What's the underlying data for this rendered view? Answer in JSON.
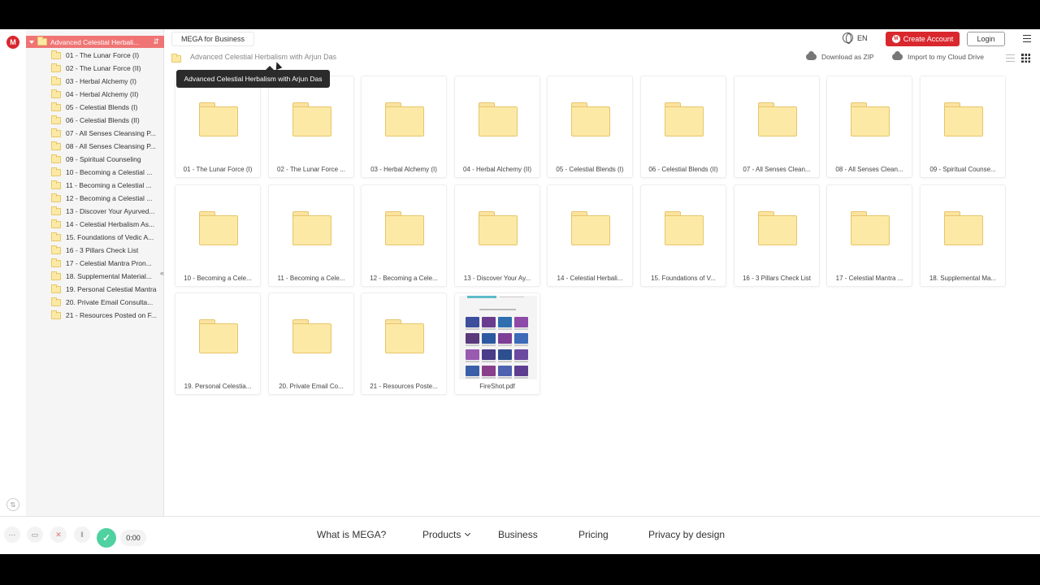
{
  "brand": {
    "logo_letter": "M"
  },
  "topbar": {
    "business_tab": "MEGA for Business",
    "language": "EN",
    "create_account": "Create Account",
    "login": "Login"
  },
  "breadcrumb": {
    "path": "Advanced Celestial Herbalism with Arjun Das",
    "download_zip": "Download as ZIP",
    "import": "Import to my Cloud Drive"
  },
  "tooltip": "Advanced Celestial Herbalism with Arjun Das",
  "tree": {
    "root": "Advanced Celestial Herbali...",
    "items": [
      "01 - The Lunar Force (I)",
      "02 - The Lunar Force (II)",
      "03 - Herbal Alchemy (I)",
      "04 - Herbal Alchemy (II)",
      "05 - Celestial Blends (I)",
      "06 - Celestial Blends (II)",
      "07 - All Senses Cleansing P...",
      "08 - All Senses Cleansing P...",
      "09 - Spiritual Counseling",
      "10 - Becoming a Celestial ...",
      "11 - Becoming a Celestial ...",
      "12 - Becoming a Celestial ...",
      "13 - Discover Your Ayurved...",
      "14 - Celestial Herbalism As...",
      "15. Foundations of Vedic A...",
      "16 - 3 Pillars Check List",
      "17 - Celestial Mantra Pron...",
      "18. Supplemental Material...",
      "19. Personal Celestial Mantra",
      "20. Private Email Consulta...",
      "21 - Resources Posted on F..."
    ]
  },
  "grid": {
    "items": [
      {
        "label": "01 - The Lunar Force (I)",
        "kind": "folder"
      },
      {
        "label": "02 - The Lunar Force ...",
        "kind": "folder"
      },
      {
        "label": "03 - Herbal Alchemy (I)",
        "kind": "folder"
      },
      {
        "label": "04 - Herbal Alchemy (II)",
        "kind": "folder"
      },
      {
        "label": "05 - Celestial Blends (I)",
        "kind": "folder"
      },
      {
        "label": "06 - Celestial Blends (II)",
        "kind": "folder"
      },
      {
        "label": "07 - All Senses Clean...",
        "kind": "folder"
      },
      {
        "label": "08 - All Senses Clean...",
        "kind": "folder"
      },
      {
        "label": "09 - Spiritual Counse...",
        "kind": "folder"
      },
      {
        "label": "10 - Becoming a Cele...",
        "kind": "folder"
      },
      {
        "label": "11 - Becoming a Cele...",
        "kind": "folder"
      },
      {
        "label": "12 - Becoming a Cele...",
        "kind": "folder"
      },
      {
        "label": "13 - Discover Your Ay...",
        "kind": "folder"
      },
      {
        "label": "14 - Celestial Herbali...",
        "kind": "folder"
      },
      {
        "label": "15. Foundations of V...",
        "kind": "folder"
      },
      {
        "label": "16 - 3 Pillars Check List",
        "kind": "folder"
      },
      {
        "label": "17 - Celestial Mantra ...",
        "kind": "folder"
      },
      {
        "label": "18. Supplemental Ma...",
        "kind": "folder"
      },
      {
        "label": "19. Personal Celestia...",
        "kind": "folder"
      },
      {
        "label": "20. Private Email Co...",
        "kind": "folder"
      },
      {
        "label": "21 - Resources Poste...",
        "kind": "folder"
      },
      {
        "label": "FireShot.pdf",
        "kind": "pdf"
      }
    ]
  },
  "footer": {
    "links": [
      "What is MEGA?",
      "Products",
      "Business",
      "Pricing",
      "Privacy by design"
    ]
  },
  "recorder": {
    "time": "0:00"
  },
  "colors": {
    "accent": "#d9272e",
    "tree_selected": "#f07474",
    "folder": "#fde9a6",
    "record_ok": "#4fd1a0"
  }
}
